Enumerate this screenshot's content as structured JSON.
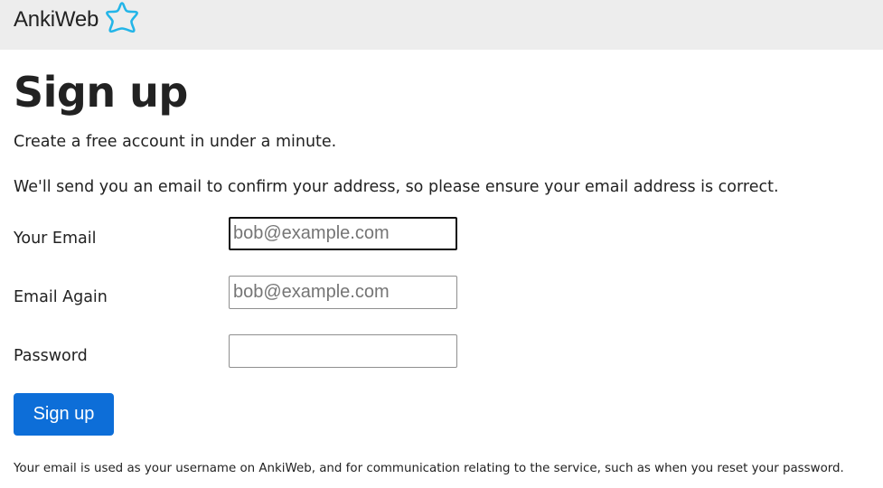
{
  "header": {
    "brand_name": "AnkiWeb",
    "brand_icon": "star-outline-icon",
    "brand_color": "#23b5e8",
    "background": "#ededed"
  },
  "main": {
    "title": "Sign up",
    "subtitle": "Create a free account in under a minute.",
    "notice": "We'll send you an email to confirm your address, so please ensure your email address is correct."
  },
  "form": {
    "email": {
      "label": "Your Email",
      "placeholder": "bob@example.com",
      "value": ""
    },
    "email_again": {
      "label": "Email Again",
      "placeholder": "bob@example.com",
      "value": ""
    },
    "password": {
      "label": "Password",
      "placeholder": "",
      "value": ""
    },
    "submit_label": "Sign up",
    "submit_color": "#0d6ed8"
  },
  "footer": {
    "note": "Your email is used as your username on AnkiWeb, and for communication relating to the service, such as when you reset your password."
  }
}
